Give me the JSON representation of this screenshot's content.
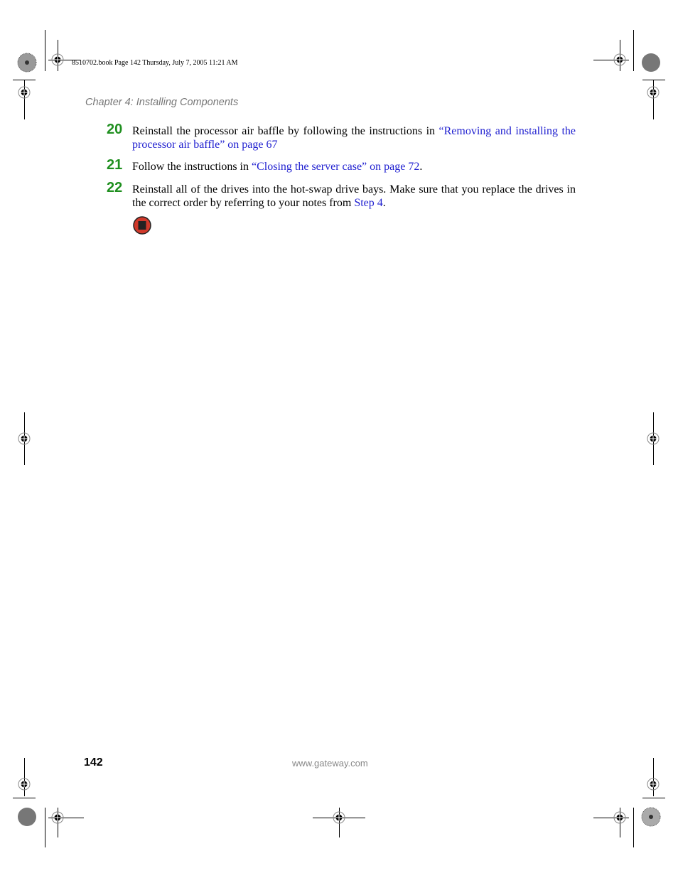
{
  "slug_line": "8510702.book  Page 142  Thursday, July 7, 2005  11:21 AM",
  "header": {
    "chapter": "Chapter 4: Installing Components"
  },
  "steps": [
    {
      "number": "20",
      "text_before": "Reinstall the processor air baffle by following the instructions in ",
      "link": "“Removing and installing the processor air baffle” on page 67",
      "text_after": ""
    },
    {
      "number": "21",
      "text_before": "Follow the instructions in ",
      "link": "“Closing the server case” on page 72",
      "text_after": "."
    },
    {
      "number": "22",
      "text_before": "Reinstall all of the drives into the hot-swap drive bays. Make sure that you replace the drives in the correct order by referring to your notes from ",
      "link": "Step 4",
      "text_after": "."
    }
  ],
  "end_icon": "stop-icon",
  "footer": {
    "page_number": "142",
    "url": "www.gateway.com"
  },
  "colors": {
    "step_number": "#1f8f1f",
    "link": "#2020d0",
    "chapter": "#777777",
    "stop_red": "#d0392b"
  }
}
